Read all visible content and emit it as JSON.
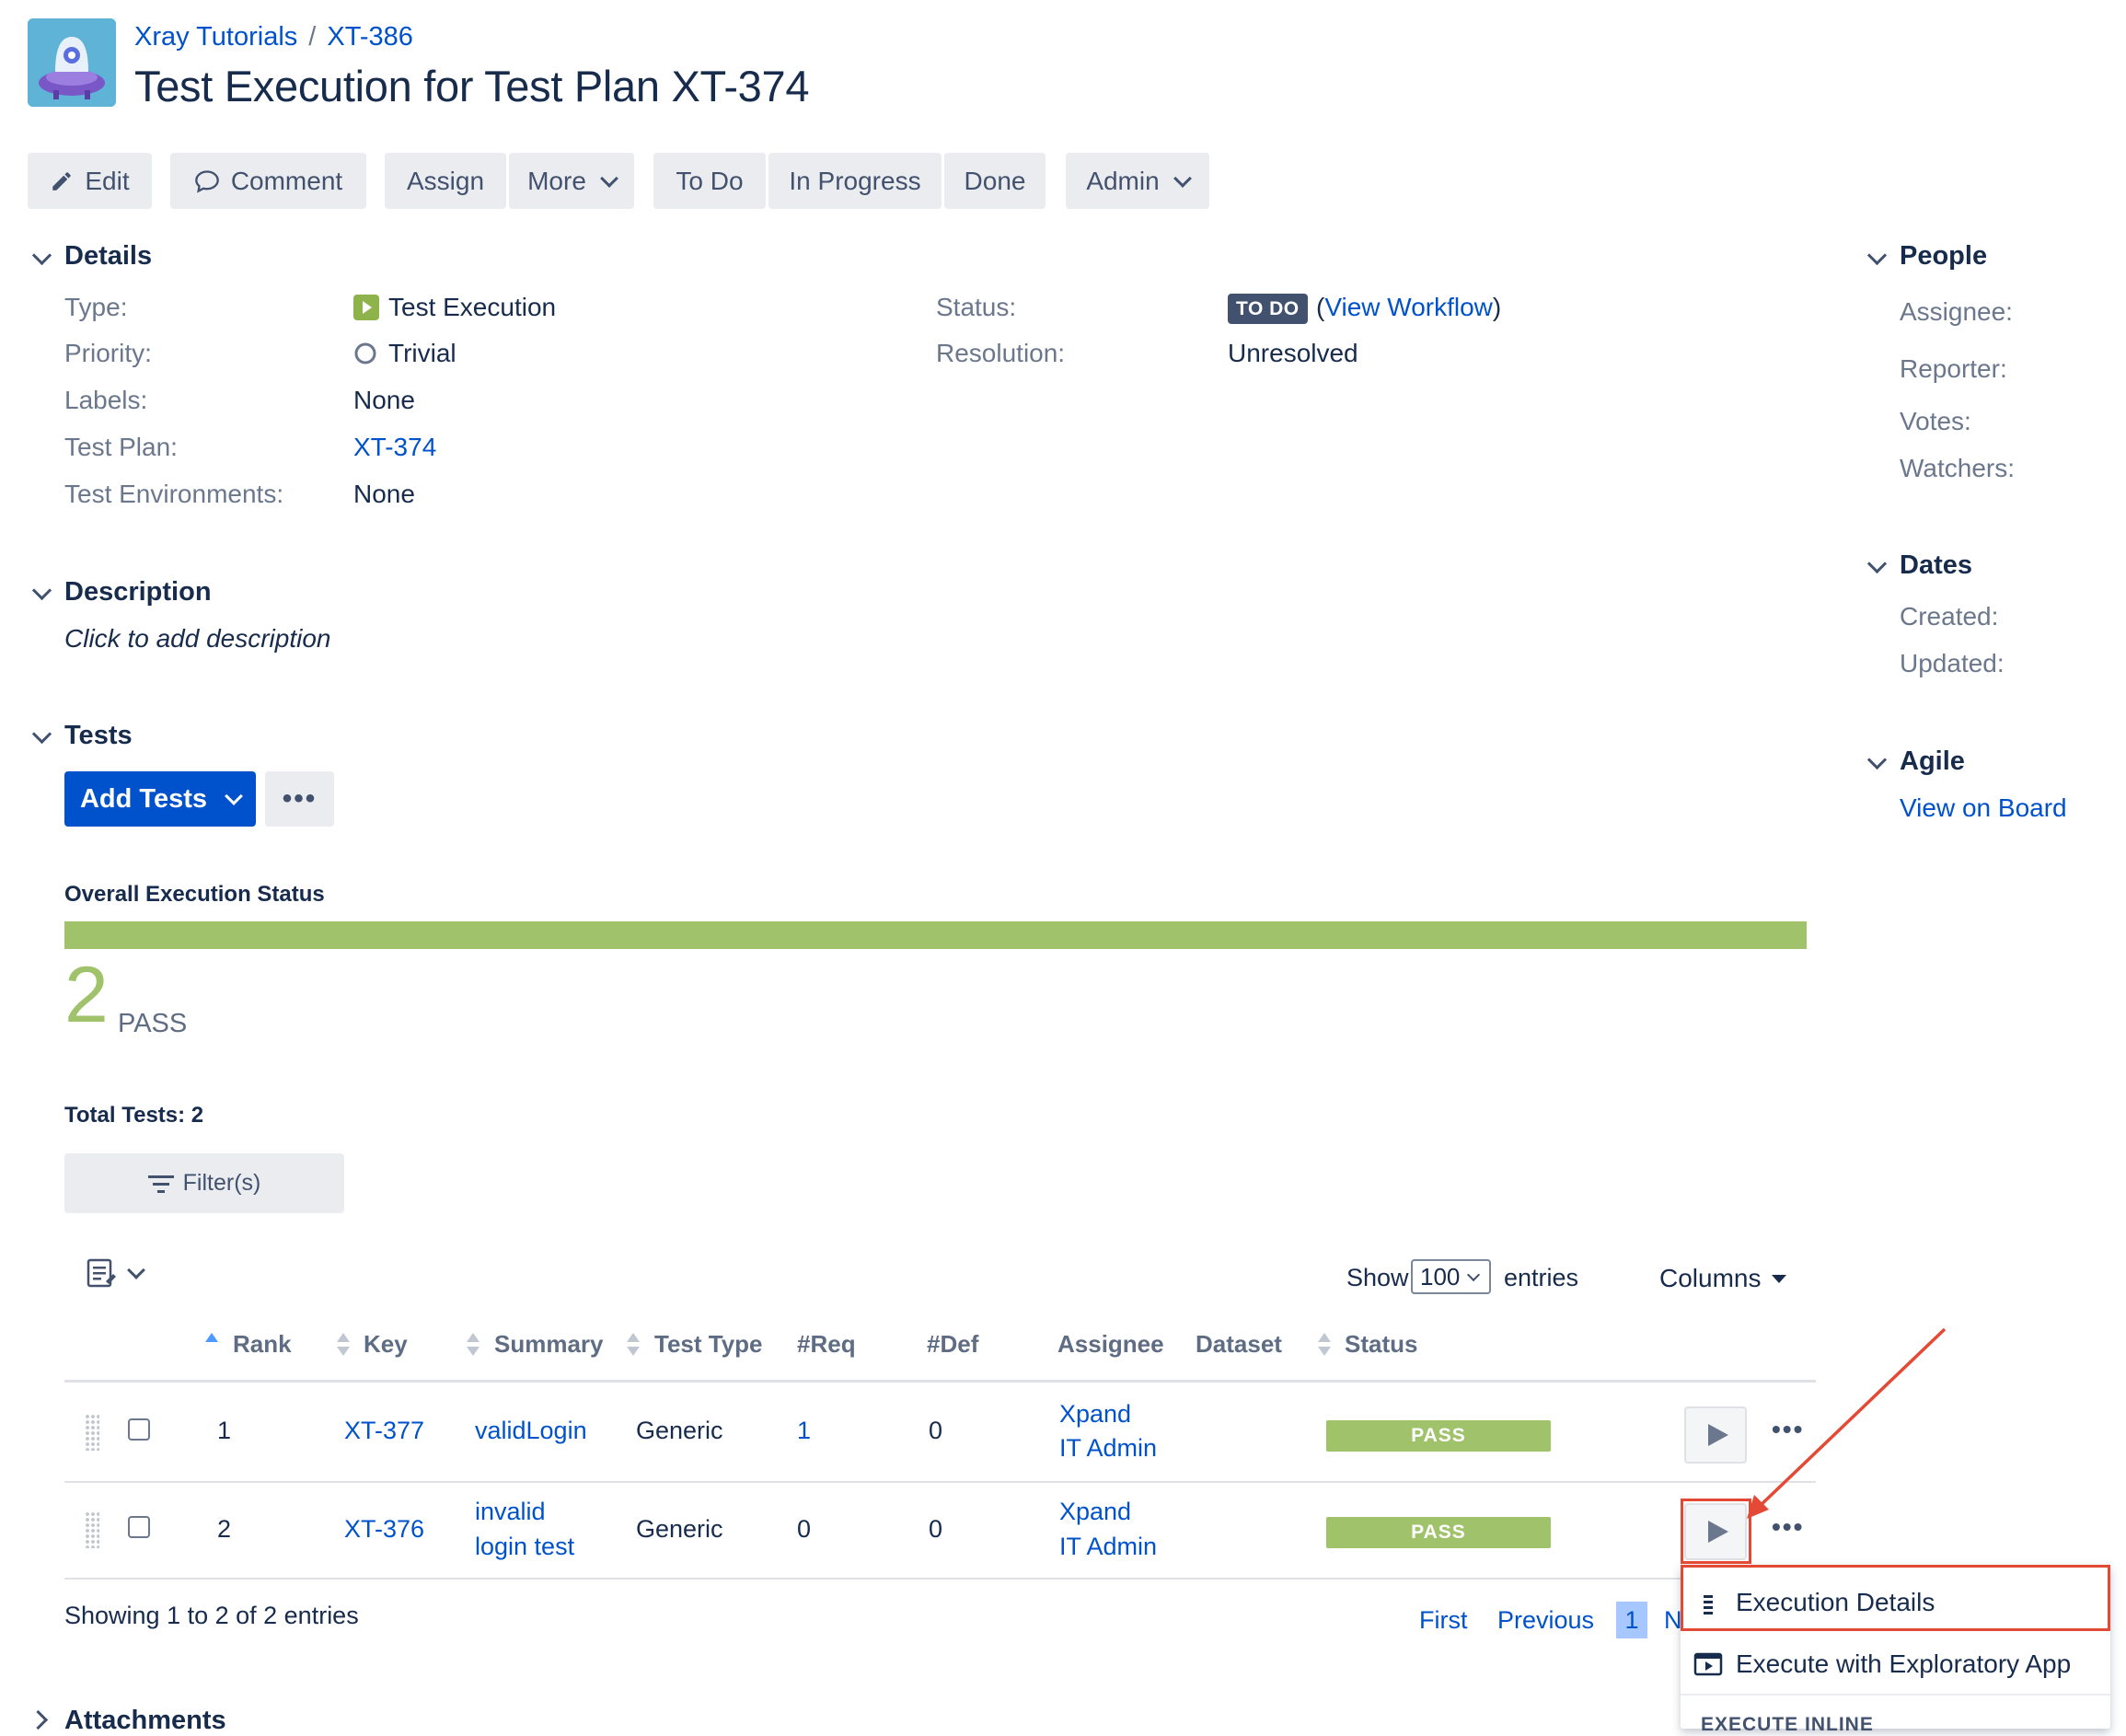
{
  "header": {
    "breadcrumb_project": "Xray Tutorials",
    "breadcrumb_sep": "/",
    "breadcrumb_parent": "XT-386",
    "title": "Test Execution for Test Plan XT-374"
  },
  "toolbar": {
    "edit": "Edit",
    "comment": "Comment",
    "assign": "Assign",
    "more": "More",
    "todo": "To Do",
    "in_progress": "In Progress",
    "done": "Done",
    "admin": "Admin"
  },
  "details": {
    "title": "Details",
    "type_label": "Type:",
    "type_value": "Test Execution",
    "priority_label": "Priority:",
    "priority_value": "Trivial",
    "labels_label": "Labels:",
    "labels_value": "None",
    "test_plan_label": "Test Plan:",
    "test_plan_value": "XT-374",
    "test_env_label": "Test Environments:",
    "test_env_value": "None",
    "status_label": "Status:",
    "status_badge": "TO DO",
    "status_open_paren": "(",
    "view_workflow": "View Workflow",
    "status_close_paren": ")",
    "resolution_label": "Resolution:",
    "resolution_value": "Unresolved"
  },
  "description": {
    "title": "Description",
    "placeholder": "Click to add description"
  },
  "tests": {
    "title": "Tests",
    "add_tests": "Add Tests",
    "more": "•••",
    "overall_status_label": "Overall Execution Status",
    "pass_count": "2",
    "pass_label": "PASS",
    "pass_fraction": 1.0,
    "total_tests": "Total Tests: 2",
    "filter_label": "Filter(s)",
    "show_label": "Show",
    "entries_value": "100",
    "entries_label": "entries",
    "columns_label": "Columns",
    "headers": {
      "rank": "Rank",
      "key": "Key",
      "summary": "Summary",
      "test_type": "Test Type",
      "req": "#Req",
      "def": "#Def",
      "assignee": "Assignee",
      "dataset": "Dataset",
      "status": "Status"
    },
    "rows": [
      {
        "rank": "1",
        "key": "XT-377",
        "summary_line1": "validLogin",
        "summary_line2": "",
        "test_type": "Generic",
        "req": "1",
        "def": "0",
        "assignee_line1": "Xpand",
        "assignee_line2": "IT Admin",
        "status": "PASS"
      },
      {
        "rank": "2",
        "key": "XT-376",
        "summary_line1": "invalid",
        "summary_line2": "login test",
        "test_type": "Generic",
        "req": "0",
        "def": "0",
        "assignee_line1": "Xpand",
        "assignee_line2": "IT Admin",
        "status": "PASS"
      }
    ],
    "showing": "Showing 1 to 2 of 2 entries",
    "pagination": {
      "first": "First",
      "previous": "Previous",
      "current": "1",
      "next_partial": "N"
    }
  },
  "row_menu": {
    "execution_details": "Execution Details",
    "execute_exploratory": "Execute with Exploratory App",
    "execute_inline_header": "EXECUTE INLINE"
  },
  "attachments": {
    "title": "Attachments"
  },
  "sidebar": {
    "people_title": "People",
    "assignee_label": "Assignee:",
    "reporter_label": "Reporter:",
    "votes_label": "Votes:",
    "watchers_label": "Watchers:",
    "dates_title": "Dates",
    "created_label": "Created:",
    "updated_label": "Updated:",
    "agile_title": "Agile",
    "view_on_board": "View on Board"
  },
  "colors": {
    "link": "#0052cc",
    "pass": "#9fc26a",
    "primary_button": "#0052cc",
    "todo_badge": "#42526e",
    "highlight": "#e34935"
  }
}
